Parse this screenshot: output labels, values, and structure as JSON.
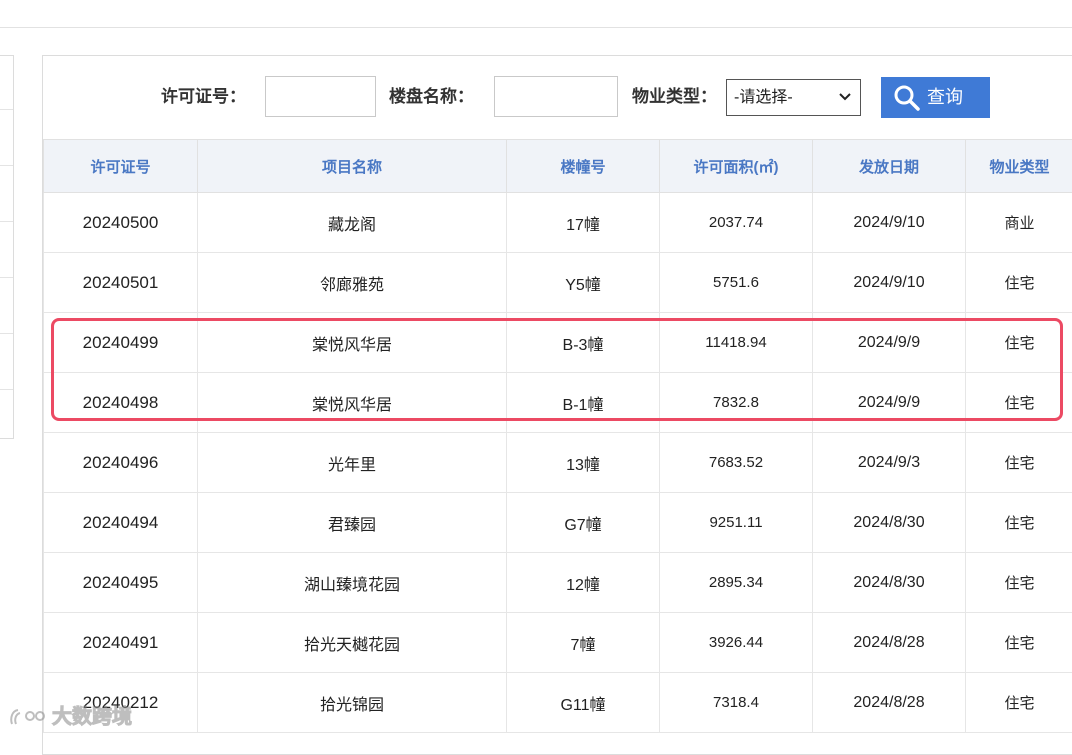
{
  "search": {
    "permit_no_label": "许可证号：",
    "permit_no_value": "",
    "project_name_label": "楼盘名称：",
    "project_name_value": "",
    "property_type_label": "物业类型：",
    "property_type_selected": "-请选择-",
    "query_button": "查询"
  },
  "table": {
    "headers": [
      "许可证号",
      "项目名称",
      "楼幢号",
      "许可面积(㎡)",
      "发放日期",
      "物业类型"
    ],
    "rows": [
      [
        "20240500",
        "藏龙阁",
        "17幢",
        "2037.74",
        "2024/9/10",
        "商业"
      ],
      [
        "20240501",
        "邻廊雅苑",
        "Y5幢",
        "5751.6",
        "2024/9/10",
        "住宅"
      ],
      [
        "20240499",
        "棠悦风华居",
        "B-3幢",
        "11418.94",
        "2024/9/9",
        "住宅"
      ],
      [
        "20240498",
        "棠悦风华居",
        "B-1幢",
        "7832.8",
        "2024/9/9",
        "住宅"
      ],
      [
        "20240496",
        "光年里",
        "13幢",
        "7683.52",
        "2024/9/3",
        "住宅"
      ],
      [
        "20240494",
        "君臻园",
        "G7幢",
        "9251.11",
        "2024/8/30",
        "住宅"
      ],
      [
        "20240495",
        "湖山臻境花园",
        "12幢",
        "2895.34",
        "2024/8/30",
        "住宅"
      ],
      [
        "20240491",
        "拾光天樾花园",
        "7幢",
        "3926.44",
        "2024/8/28",
        "住宅"
      ],
      [
        "20240212",
        "拾光锦园",
        "G11幢",
        "7318.4",
        "2024/8/28",
        "住宅"
      ]
    ]
  },
  "watermark": {
    "text": "大数跨境"
  },
  "colors": {
    "header_text": "#4a78c4",
    "header_bg": "#f0f3f8",
    "query_button_bg": "#3f7ad6",
    "highlight_border": "#ec4a63"
  },
  "icons": {
    "query_button_icon": "search-icon",
    "select_icon": "chevron-down-icon"
  }
}
